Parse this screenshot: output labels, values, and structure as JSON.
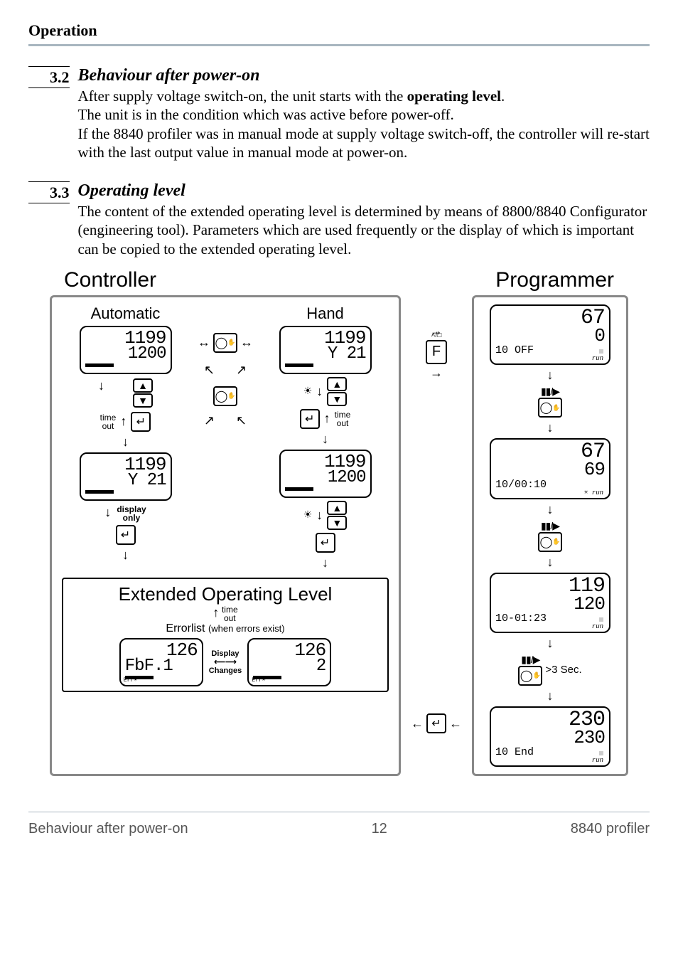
{
  "header": "Operation",
  "sections": [
    {
      "num": "3.2",
      "title": "Behaviour after power-on",
      "body_parts": [
        "After supply voltage switch-on, the unit starts with the ",
        "operating level",
        "."
      ],
      "body_rest": "The unit is in the condition which was active before power-off.\nIf the 8840 profiler  was in manual mode at supply voltage switch-off, the controller will re-start with the last output value in manual mode at power-on."
    },
    {
      "num": "3.3",
      "title": "Operating level",
      "body": "The content of the extended operating level is determined by means of 8800/8840 Configurator (engineering tool). Parameters which are used frequently or the display of which is important can be copied to the extended operating level."
    }
  ],
  "diagram": {
    "controller_title": "Controller",
    "programmer_title": "Programmer",
    "automatic": "Automatic",
    "hand": "Hand",
    "time_out": "time\nout",
    "display_only": "display\nonly",
    "extended_title": "Extended Operating Level",
    "errorlist": "Errorlist",
    "errorlist_sub": "(when errors exist)",
    "display_label": "Display",
    "changes_label": "Changes",
    "gt3sec": ">3 Sec.",
    "lcd_auto1": {
      "l1": "1199",
      "l2": "1200"
    },
    "lcd_auto2": {
      "l1": "1199",
      "l2": "Y  21"
    },
    "lcd_hand1": {
      "l1": "1199",
      "l2": "Y  21"
    },
    "lcd_hand2": {
      "l1": "1199",
      "l2": "1200"
    },
    "lcd_err1": {
      "l1": "126",
      "l2": "FbF.1"
    },
    "lcd_err2": {
      "l1": "126",
      "l2": "2"
    },
    "prog": [
      {
        "l1": "67",
        "l2": "0",
        "l3": "10 OFF"
      },
      {
        "l1": "67",
        "l2": "69",
        "l3": "10/00:10"
      },
      {
        "l1": "119",
        "l2": "120",
        "l3": "10-01:23"
      },
      {
        "l1": "230",
        "l2": "230",
        "l3": "10 End"
      }
    ]
  },
  "footer": {
    "left": "Behaviour after power-on",
    "center": "12",
    "right": "8840 profiler"
  }
}
